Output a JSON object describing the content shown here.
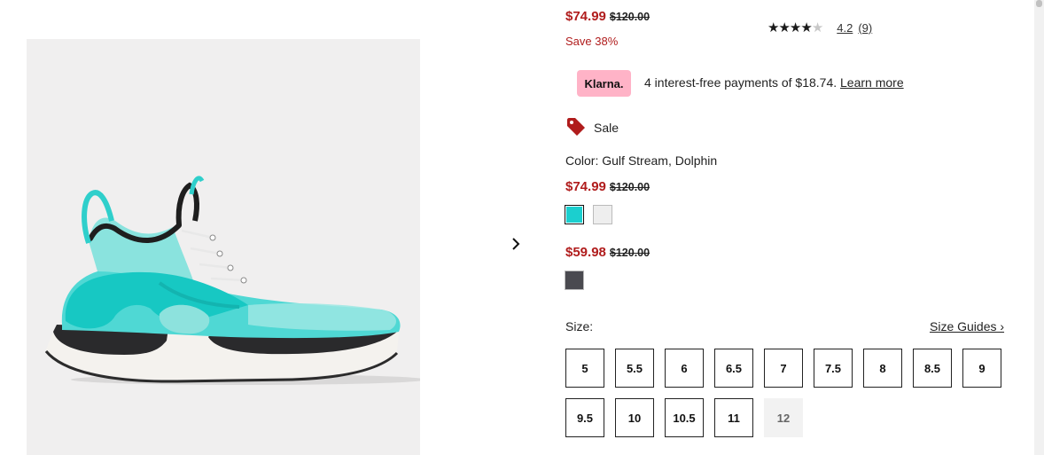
{
  "product": {
    "image_alt": "Women's SH/FT Aurora Outdry Shoe",
    "main_price": {
      "sale": "$74.99",
      "original": "$120.00"
    },
    "save_text": "Save 38%",
    "rating": {
      "value": "4.2",
      "count": "(9)",
      "stars": 4.2,
      "max_stars": 5
    }
  },
  "klarna": {
    "badge": "Klarna.",
    "text": "4 interest-free payments of $18.74.",
    "learn_more": "Learn more"
  },
  "sale_badge": {
    "label": "Sale"
  },
  "color": {
    "label": "Color:",
    "value": "Gulf Stream, Dolphin",
    "price_groups": [
      {
        "sale": "$74.99",
        "original": "$120.00",
        "swatches": [
          {
            "name": "Gulf Stream, Dolphin",
            "color": "#1bcfcf",
            "selected": true
          },
          {
            "name": "White",
            "color": "#eeeeee",
            "selected": false
          }
        ]
      },
      {
        "sale": "$59.98",
        "original": "$120.00",
        "swatches": [
          {
            "name": "Dark Grey",
            "color": "#4a4a50",
            "selected": false
          }
        ]
      }
    ]
  },
  "size": {
    "label": "Size:",
    "guide": "Size Guides ›",
    "options": [
      {
        "label": "5",
        "available": true
      },
      {
        "label": "5.5",
        "available": true
      },
      {
        "label": "6",
        "available": true
      },
      {
        "label": "6.5",
        "available": true
      },
      {
        "label": "7",
        "available": true
      },
      {
        "label": "7.5",
        "available": true
      },
      {
        "label": "8",
        "available": true
      },
      {
        "label": "8.5",
        "available": true
      },
      {
        "label": "9",
        "available": true
      },
      {
        "label": "9.5",
        "available": true
      },
      {
        "label": "10",
        "available": true
      },
      {
        "label": "10.5",
        "available": true
      },
      {
        "label": "11",
        "available": true
      },
      {
        "label": "12",
        "available": false
      }
    ]
  },
  "icons": {
    "next": "chevron-right-icon",
    "sale": "price-tag-icon",
    "star": "star-icon"
  },
  "colors": {
    "sale_red": "#b01c1c",
    "klarna_pink": "#ffb3c7"
  }
}
